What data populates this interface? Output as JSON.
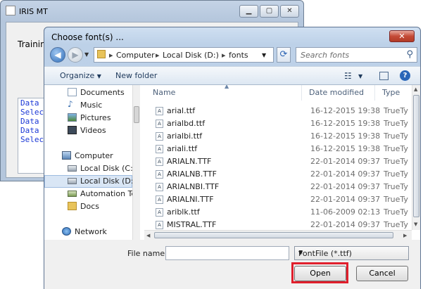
{
  "background_window": {
    "title": "IRIS MT",
    "training_label": "Training",
    "log_lines": [
      "Data S",
      "Select",
      "Data S",
      "Data S",
      "Select"
    ],
    "log_color": "#1a37d6"
  },
  "dialog": {
    "title": "Choose font(s) ...",
    "close_label": "✕",
    "breadcrumb": [
      "Computer",
      "Local Disk (D:)",
      "fonts"
    ],
    "search_placeholder": "Search fonts",
    "toolbar": {
      "organize_label": "Organize",
      "new_folder_label": "New folder"
    },
    "nav": {
      "libraries": [
        {
          "label": "Documents",
          "icon": "documents-icon"
        },
        {
          "label": "Music",
          "icon": "music-icon"
        },
        {
          "label": "Pictures",
          "icon": "pictures-icon"
        },
        {
          "label": "Videos",
          "icon": "videos-icon"
        }
      ],
      "computer_label": "Computer",
      "drives": [
        {
          "label": "Local Disk (C:)",
          "icon": "drive-icon"
        },
        {
          "label": "Local Disk (D:)",
          "icon": "drive-icon",
          "selected": true
        },
        {
          "label": "Automation Tes",
          "icon": "network-drive-icon"
        },
        {
          "label": "Docs",
          "icon": "folder-icon"
        }
      ],
      "network_label": "Network"
    },
    "columns": {
      "name": "Name",
      "date_modified": "Date modified",
      "type": "Type"
    },
    "files": [
      {
        "name": "arial.ttf",
        "date": "16-12-2015 19:38",
        "type": "TrueTy"
      },
      {
        "name": "arialbd.ttf",
        "date": "16-12-2015 19:38",
        "type": "TrueTy"
      },
      {
        "name": "arialbi.ttf",
        "date": "16-12-2015 19:38",
        "type": "TrueTy"
      },
      {
        "name": "ariali.ttf",
        "date": "16-12-2015 19:38",
        "type": "TrueTy"
      },
      {
        "name": "ARIALN.TTF",
        "date": "22-01-2014 09:37",
        "type": "TrueTy"
      },
      {
        "name": "ARIALNB.TTF",
        "date": "22-01-2014 09:37",
        "type": "TrueTy"
      },
      {
        "name": "ARIALNBI.TTF",
        "date": "22-01-2014 09:37",
        "type": "TrueTy"
      },
      {
        "name": "ARIALNI.TTF",
        "date": "22-01-2014 09:37",
        "type": "TrueTy"
      },
      {
        "name": "ariblk.ttf",
        "date": "11-06-2009 02:13",
        "type": "TrueTy"
      },
      {
        "name": "MISTRAL.TTF",
        "date": "22-01-2014 09:37",
        "type": "TrueTy"
      }
    ],
    "file_name_label": "File name:",
    "file_name_value": "",
    "filter_value": "FontFile (*.ttf)",
    "open_label": "Open",
    "cancel_label": "Cancel",
    "highlight_color": "#e01f2c"
  }
}
